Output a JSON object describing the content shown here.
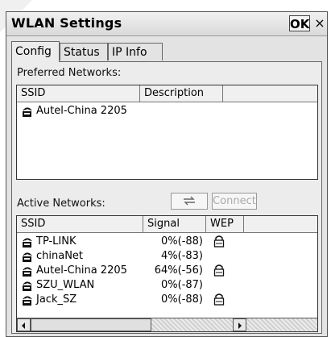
{
  "window": {
    "title": "WLAN Settings",
    "ok_label": "OK",
    "close_label": "×"
  },
  "tabs": [
    {
      "label": "Config",
      "active": true
    },
    {
      "label": "Status",
      "active": false
    },
    {
      "label": "IP Info",
      "active": false
    }
  ],
  "preferred": {
    "label": "Preferred Networks:",
    "columns": [
      "SSID",
      "Description"
    ],
    "rows": [
      {
        "ssid": "Autel-China 2205",
        "description": ""
      }
    ]
  },
  "active": {
    "label": "Active Networks:",
    "refresh_icon": "refresh-arrows-icon",
    "connect_label": "Connect",
    "columns": [
      "SSID",
      "Signal",
      "WEP"
    ],
    "rows": [
      {
        "ssid": "TP-LINK",
        "signal": "0%(-88)",
        "wep": true
      },
      {
        "ssid": "chinaNet",
        "signal": "4%(-83)",
        "wep": false
      },
      {
        "ssid": "Autel-China 2205",
        "signal": "64%(-56)",
        "wep": true
      },
      {
        "ssid": "SZU_WLAN",
        "signal": "0%(-87)",
        "wep": false
      },
      {
        "ssid": "Jack_SZ",
        "signal": "0%(-88)",
        "wep": true
      }
    ]
  },
  "icons": {
    "network": "wireless-network-icon",
    "lock": "lock-icon"
  }
}
